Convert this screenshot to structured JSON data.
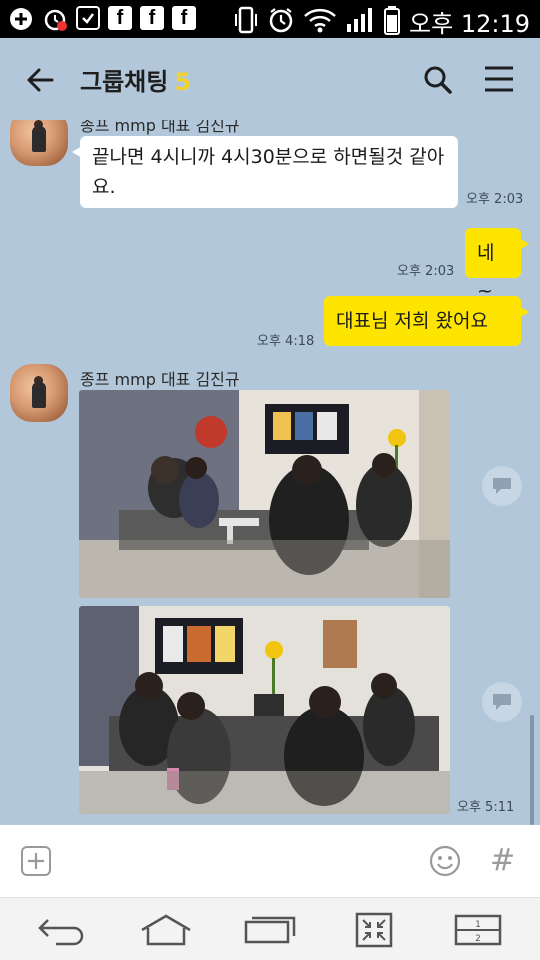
{
  "status_bar": {
    "time": "오후 12:19",
    "icons": [
      "plus-icon",
      "alarm-icon",
      "check-box-icon",
      "facebook-icon",
      "facebook-icon",
      "facebook-icon",
      "vibrate-icon",
      "alarm-clock-icon",
      "wifi-icon",
      "signal-icon",
      "battery-icon"
    ]
  },
  "header": {
    "title": "그룹채팅",
    "member_count": "5",
    "back_icon": "arrow-left-icon",
    "search_icon": "search-icon",
    "menu_icon": "hamburger-menu-icon",
    "accent_color": "#f2d32e"
  },
  "messages": {
    "sender_top": "종프 mmp 대표 김진규",
    "msg1_text": "끝나면 4시니까 4시30분으로 하면될것 같아요.",
    "msg1_time": "오후 2:03",
    "msg2_text": "네~",
    "msg2_time": "오후 2:03",
    "msg3_text": "대표님 저희 왔어요",
    "msg3_time": "오후 4:18",
    "sender_photos": "종프 mmp 대표 김진규",
    "photos_time": "오후 5:11"
  },
  "colors": {
    "chat_background": "#b2c7d9",
    "my_bubble": "#fee500",
    "other_bubble": "#ffffff"
  },
  "input_bar": {
    "plus_icon": "plus-square-icon",
    "emoji_icon": "emoji-smile-icon",
    "hash_label": "#"
  },
  "nav_bar": {
    "icons": [
      "back-icon",
      "home-icon",
      "recent-apps-icon",
      "collapse-icon",
      "split-screen-icon"
    ],
    "split_top": "1",
    "split_bottom": "2"
  }
}
